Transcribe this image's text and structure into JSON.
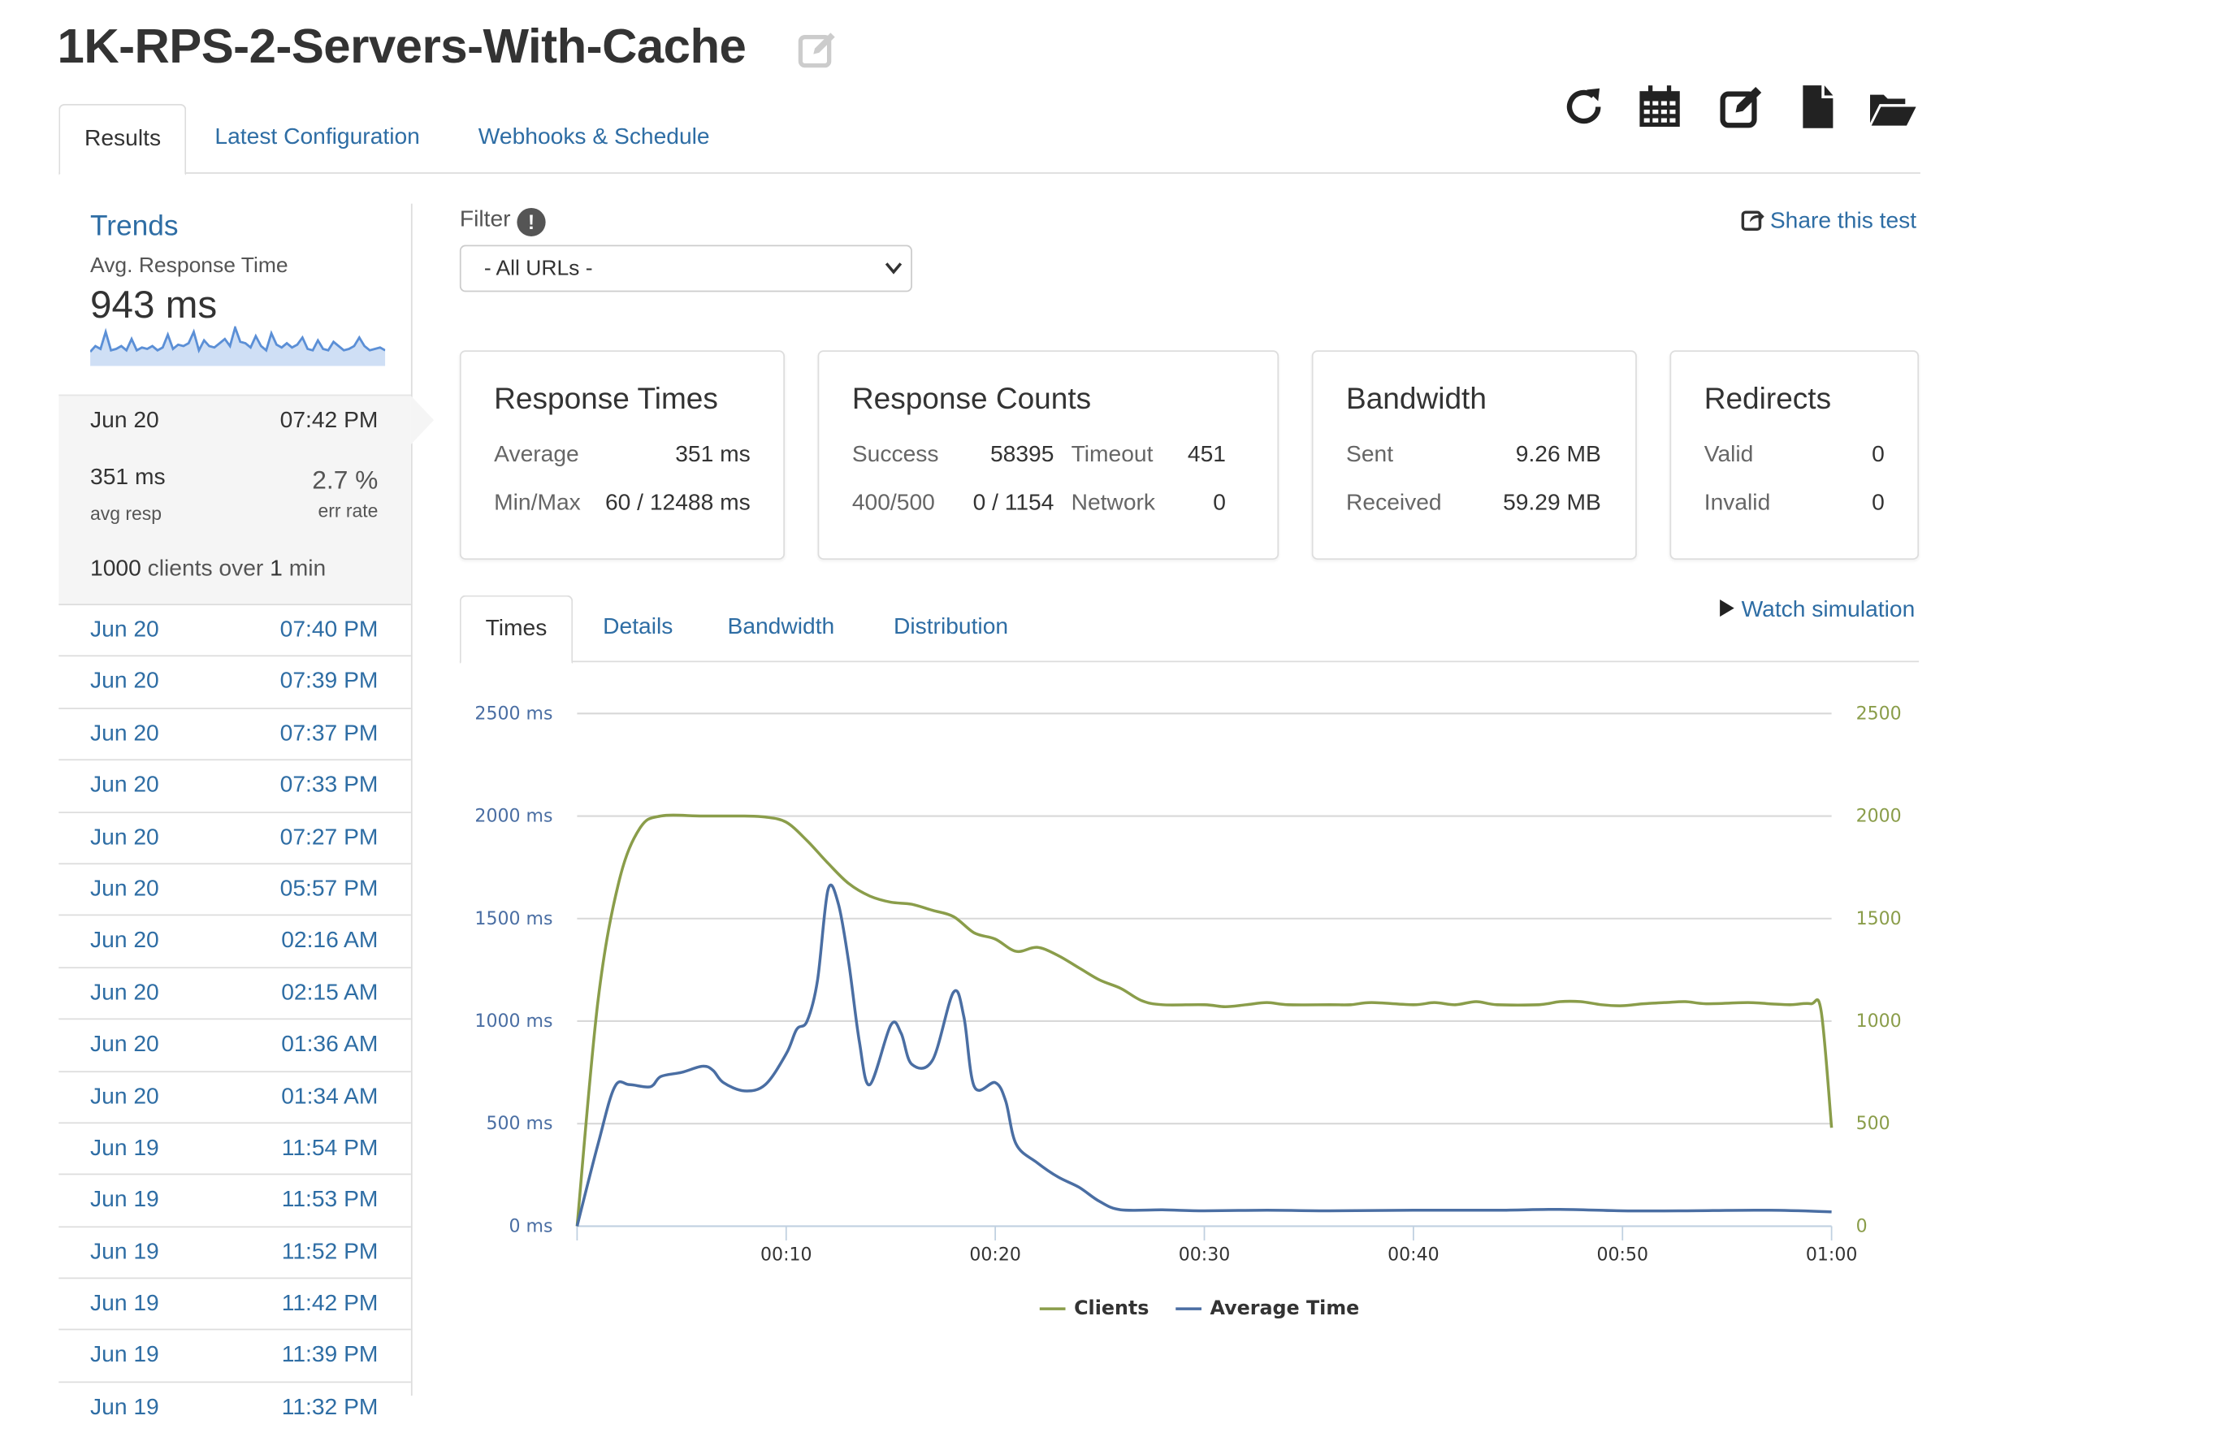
{
  "header": {
    "title": "1K-RPS-2-Servers-With-Cache"
  },
  "tabs": [
    {
      "label": "Results"
    },
    {
      "label": "Latest Configuration"
    },
    {
      "label": "Webhooks & Schedule"
    }
  ],
  "toolbar": {
    "icons": [
      "refresh-icon",
      "calendar-icon",
      "edit-icon",
      "file-icon",
      "folder-open-icon"
    ]
  },
  "sidebar": {
    "trends_title": "Trends",
    "trends_subtitle": "Avg. Response Time",
    "trends_value": "943 ms",
    "sparkline": [
      18,
      14,
      16,
      4,
      17,
      16,
      14,
      17,
      9,
      17,
      15,
      16,
      14,
      17,
      15,
      6,
      16,
      13,
      14,
      12,
      4,
      17,
      10,
      14,
      15,
      12,
      9,
      14,
      1,
      11,
      12,
      15,
      7,
      14,
      17,
      5,
      13,
      15,
      12,
      15,
      13,
      8,
      16,
      17,
      10,
      16,
      17,
      11,
      14,
      17,
      16,
      14,
      8,
      14,
      17,
      16,
      15,
      17
    ],
    "current": {
      "date": "Jun 20",
      "time": "07:42 PM",
      "avg_resp_value": "351 ms",
      "avg_resp_label": "avg resp",
      "err_rate_value": "2.7 %",
      "err_rate_label": "err rate",
      "clients_prefix": "1000",
      "clients_mid": "clients over",
      "clients_dur": "1",
      "clients_unit": "min"
    },
    "history": [
      {
        "date": "Jun 20",
        "time": "07:40 PM"
      },
      {
        "date": "Jun 20",
        "time": "07:39 PM"
      },
      {
        "date": "Jun 20",
        "time": "07:37 PM"
      },
      {
        "date": "Jun 20",
        "time": "07:33 PM"
      },
      {
        "date": "Jun 20",
        "time": "07:27 PM"
      },
      {
        "date": "Jun 20",
        "time": "05:57 PM"
      },
      {
        "date": "Jun 20",
        "time": "02:16 AM"
      },
      {
        "date": "Jun 20",
        "time": "02:15 AM"
      },
      {
        "date": "Jun 20",
        "time": "01:36 AM"
      },
      {
        "date": "Jun 20",
        "time": "01:34 AM"
      },
      {
        "date": "Jun 19",
        "time": "11:54 PM"
      },
      {
        "date": "Jun 19",
        "time": "11:53 PM"
      },
      {
        "date": "Jun 19",
        "time": "11:52 PM"
      },
      {
        "date": "Jun 19",
        "time": "11:42 PM"
      },
      {
        "date": "Jun 19",
        "time": "11:39 PM"
      },
      {
        "date": "Jun 19",
        "time": "11:32 PM"
      }
    ]
  },
  "filter": {
    "label": "Filter",
    "info": "!",
    "selected": "- All URLs -"
  },
  "share_label": "Share this test",
  "cards": {
    "response_times": {
      "title": "Response Times",
      "average_label": "Average",
      "average_value": "351 ms",
      "minmax_label": "Min/Max",
      "minmax_value": "60 / 12488 ms"
    },
    "response_counts": {
      "title": "Response Counts",
      "success_label": "Success",
      "success_value": "58395",
      "timeout_label": "Timeout",
      "timeout_value": "451",
      "e400_500_label": "400/500",
      "e400_500_value": "0 / 1154",
      "network_label": "Network",
      "network_value": "0"
    },
    "bandwidth": {
      "title": "Bandwidth",
      "sent_label": "Sent",
      "sent_value": "9.26 MB",
      "received_label": "Received",
      "received_value": "59.29 MB"
    },
    "redirects": {
      "title": "Redirects",
      "valid_label": "Valid",
      "valid_value": "0",
      "invalid_label": "Invalid",
      "invalid_value": "0"
    }
  },
  "subtabs": [
    {
      "label": "Times"
    },
    {
      "label": "Details"
    },
    {
      "label": "Bandwidth"
    },
    {
      "label": "Distribution"
    }
  ],
  "watch_label": "Watch simulation",
  "colors": {
    "link": "#2e6da4",
    "clients": "#8a9d4a",
    "average_time": "#4a6ea3",
    "sparkline": "#5b8fd6"
  },
  "chart_data": {
    "type": "line",
    "x_ticks": [
      "00:10",
      "00:20",
      "00:30",
      "00:40",
      "00:50",
      "01:00"
    ],
    "x_tick_seconds": [
      10,
      20,
      30,
      40,
      50,
      60
    ],
    "xlim": [
      0,
      60
    ],
    "y_left_ticks": [
      "0 ms",
      "500 ms",
      "1000 ms",
      "1500 ms",
      "2000 ms",
      "2500 ms"
    ],
    "y_right_ticks": [
      "0",
      "500",
      "1000",
      "1500",
      "2000",
      "2500"
    ],
    "ylim": [
      0,
      2500
    ],
    "grid": true,
    "legend": "bottom-center",
    "series": [
      {
        "name": "Clients",
        "points": [
          [
            0,
            0
          ],
          [
            1,
            1100
          ],
          [
            2,
            1680
          ],
          [
            3,
            1940
          ],
          [
            4,
            2000
          ],
          [
            6,
            2000
          ],
          [
            8,
            2000
          ],
          [
            9,
            1995
          ],
          [
            10,
            1970
          ],
          [
            11,
            1880
          ],
          [
            12,
            1770
          ],
          [
            13,
            1670
          ],
          [
            14,
            1610
          ],
          [
            15,
            1580
          ],
          [
            16,
            1570
          ],
          [
            17,
            1540
          ],
          [
            18,
            1510
          ],
          [
            19,
            1430
          ],
          [
            20,
            1400
          ],
          [
            21,
            1340
          ],
          [
            22,
            1360
          ],
          [
            23,
            1320
          ],
          [
            24,
            1260
          ],
          [
            25,
            1200
          ],
          [
            26,
            1160
          ],
          [
            27,
            1100
          ],
          [
            28,
            1080
          ],
          [
            30,
            1080
          ],
          [
            31,
            1070
          ],
          [
            32,
            1080
          ],
          [
            33,
            1090
          ],
          [
            34,
            1080
          ],
          [
            36,
            1080
          ],
          [
            37,
            1080
          ],
          [
            38,
            1090
          ],
          [
            40,
            1080
          ],
          [
            41,
            1090
          ],
          [
            42,
            1080
          ],
          [
            43,
            1095
          ],
          [
            44,
            1080
          ],
          [
            46,
            1080
          ],
          [
            47,
            1095
          ],
          [
            48,
            1095
          ],
          [
            49,
            1080
          ],
          [
            50,
            1075
          ],
          [
            51,
            1085
          ],
          [
            52,
            1090
          ],
          [
            53,
            1095
          ],
          [
            54,
            1085
          ],
          [
            56,
            1090
          ],
          [
            57,
            1085
          ],
          [
            58,
            1080
          ],
          [
            59,
            1085
          ],
          [
            59.5,
            1050
          ],
          [
            60,
            480
          ]
        ]
      },
      {
        "name": "Average Time",
        "points": [
          [
            0,
            0
          ],
          [
            1,
            400
          ],
          [
            1.8,
            680
          ],
          [
            2.5,
            690
          ],
          [
            3.5,
            680
          ],
          [
            4,
            730
          ],
          [
            5,
            750
          ],
          [
            6,
            780
          ],
          [
            6.5,
            760
          ],
          [
            7,
            700
          ],
          [
            8,
            660
          ],
          [
            9,
            690
          ],
          [
            10,
            840
          ],
          [
            10.5,
            960
          ],
          [
            11,
            1000
          ],
          [
            11.5,
            1200
          ],
          [
            12,
            1640
          ],
          [
            12.5,
            1570
          ],
          [
            13,
            1280
          ],
          [
            13.5,
            900
          ],
          [
            14,
            690
          ],
          [
            15,
            980
          ],
          [
            15.5,
            940
          ],
          [
            16,
            790
          ],
          [
            17,
            810
          ],
          [
            18,
            1140
          ],
          [
            18.5,
            1020
          ],
          [
            19,
            680
          ],
          [
            20,
            700
          ],
          [
            20.5,
            610
          ],
          [
            21,
            400
          ],
          [
            22,
            310
          ],
          [
            23,
            240
          ],
          [
            24,
            190
          ],
          [
            25,
            120
          ],
          [
            26,
            80
          ],
          [
            28,
            80
          ],
          [
            30,
            75
          ],
          [
            33,
            78
          ],
          [
            36,
            75
          ],
          [
            40,
            78
          ],
          [
            44,
            78
          ],
          [
            47,
            82
          ],
          [
            50,
            75
          ],
          [
            53,
            75
          ],
          [
            57,
            78
          ],
          [
            60,
            70
          ]
        ]
      }
    ]
  }
}
